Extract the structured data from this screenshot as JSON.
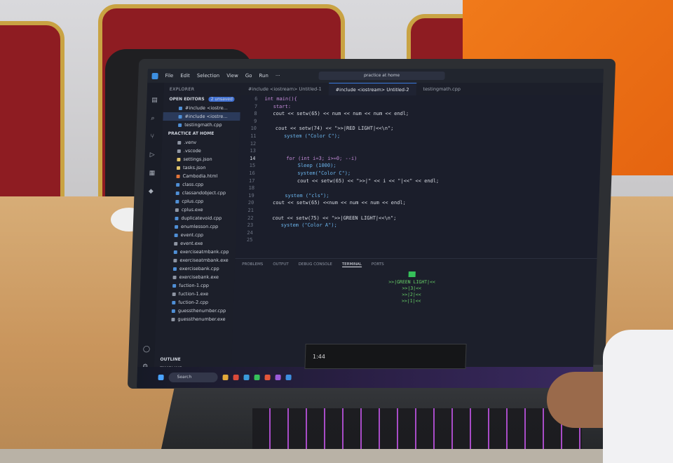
{
  "vscode": {
    "menu": [
      "File",
      "Edit",
      "Selection",
      "View",
      "Go",
      "Run",
      "···"
    ],
    "search_text": "practice at home",
    "tabs": [
      "#include <iostream> Untitled-1",
      "#include <iostream> Untitled-2",
      "testingmath.cpp"
    ],
    "explorer_title": "EXPLORER",
    "open_editors_title": "OPEN EDITORS",
    "open_editors_badge": "2 unsaved",
    "open_editors": [
      "#include <iostre...",
      "#include <iostre...",
      "testingmath.cpp"
    ],
    "folder_title": "PRACTICE AT HOME",
    "files": [
      ".venv",
      ".vscode",
      "settings.json",
      "tasks.json",
      "Cambodia.html",
      "class.cpp",
      "classandobject.cpp",
      "cplus.cpp",
      "cplus.exe",
      "duplicatevoid.cpp",
      "enumlesson.cpp",
      "event.cpp",
      "event.exe",
      "exerciseatmbank.cpp",
      "exerciseatmbank.exe",
      "exercisebank.cpp",
      "exercisebank.exe",
      "fuction-1.cpp",
      "fuction-1.exe",
      "fuction-2.cpp",
      "guessthenumber.cpp",
      "guessthenumber.exe"
    ],
    "bottom_sections": [
      "OUTLINE",
      "TIMELINE"
    ],
    "code": [
      {
        "ln": "6",
        "text": "int main(){"
      },
      {
        "ln": "7",
        "text": "   start:"
      },
      {
        "ln": "8",
        "text": "   cout << setw(65) << num << num << num << endl;"
      },
      {
        "ln": "9",
        "text": ""
      },
      {
        "ln": "10",
        "text": "    cout << setw(74) << \">>|RED LIGHT|<<\\n\";"
      },
      {
        "ln": "11",
        "text": "       system (\"Color C\");"
      },
      {
        "ln": "12",
        "text": ""
      },
      {
        "ln": "13",
        "text": ""
      },
      {
        "ln": "14",
        "text": "        for (int i=3; i>=0; --i)"
      },
      {
        "ln": "15",
        "text": "            Sleep (1000);"
      },
      {
        "ln": "16",
        "text": "            system(\"Color C\");"
      },
      {
        "ln": "17",
        "text": "            cout << setw(65) << \">>|\" << i << \"|<<\" << endl;"
      },
      {
        "ln": "18",
        "text": ""
      },
      {
        "ln": "19",
        "text": "        system (\"cls\");"
      },
      {
        "ln": "20",
        "text": "    cout << setw(65) <<num << num << num << endl;"
      },
      {
        "ln": "21",
        "text": ""
      },
      {
        "ln": "22",
        "text": "    cout << setw(75) << \">>|GREEN LIGHT|<<\\n\";"
      },
      {
        "ln": "23",
        "text": "       system (\"Color A\");"
      },
      {
        "ln": "24",
        "text": ""
      },
      {
        "ln": "25",
        "text": ""
      }
    ],
    "panel_tabs": [
      "PROBLEMS",
      "OUTPUT",
      "DEBUG CONSOLE",
      "TERMINAL",
      "PORTS"
    ],
    "terminal_lines": [
      ">>|GREEN LIGHT|<<",
      ">>|3|<<",
      ">>|2|<<",
      ">>|1|<<"
    ],
    "taskbar_search": "Search",
    "time_display": "1:44"
  }
}
